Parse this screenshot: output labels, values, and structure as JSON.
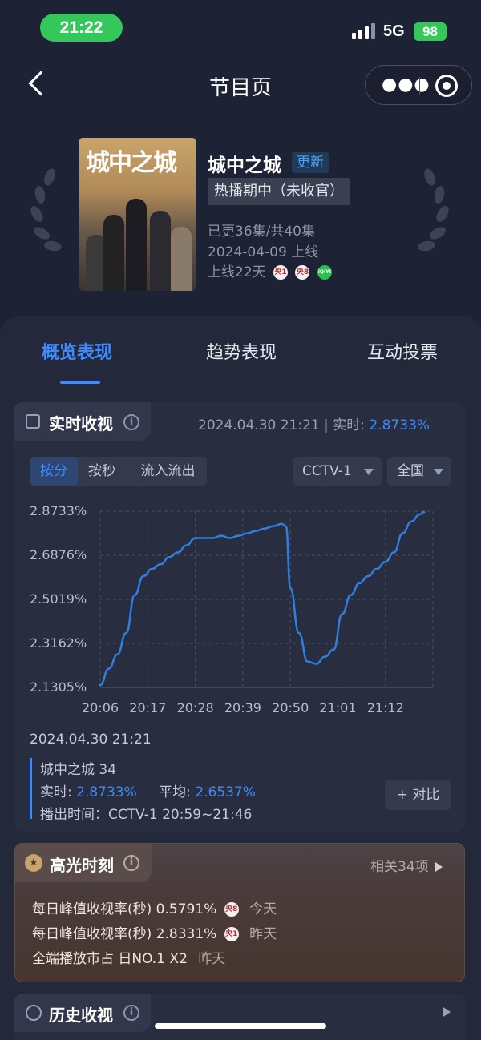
{
  "status_bar": {
    "time": "21:22",
    "network": "5G",
    "battery": "98"
  },
  "nav": {
    "title": "节目页",
    "more_icon": "more-icon",
    "close_icon": "target-icon"
  },
  "show": {
    "poster_title": "城中之城",
    "title": "城中之城",
    "update_tag": "更新",
    "status_tag": "热播期中（未收官）",
    "episodes": "已更36集/共40集",
    "premiere": "2024-04-09 上线",
    "online_days": "上线22天",
    "channels": [
      {
        "label": "央1",
        "color": "#c0282d"
      },
      {
        "label": "央8",
        "color": "#c0282d"
      },
      {
        "label": "iQIYI",
        "color": "#27c24c"
      }
    ]
  },
  "tabs": [
    {
      "label": "概览表现",
      "active": true
    },
    {
      "label": "趋势表现",
      "active": false
    },
    {
      "label": "互动投票",
      "active": false
    }
  ],
  "realtime": {
    "title": "实时收视",
    "timestamp": "2024.04.30 21:21",
    "realtime_label": "实时:",
    "realtime_value": "2.8733%",
    "segments": [
      "按分",
      "按秒",
      "流入流出"
    ],
    "active_segment": "按分",
    "channel_select": "CCTV-1",
    "region_select": "全国"
  },
  "chart_data": {
    "type": "line",
    "title": "",
    "xlabel": "",
    "ylabel": "",
    "y_tick_labels": [
      "2.8733%",
      "2.6876%",
      "2.5019%",
      "2.3162%",
      "2.1305%"
    ],
    "x_tick_labels": [
      "20:06",
      "20:17",
      "20:28",
      "20:39",
      "20:50",
      "21:01",
      "21:12"
    ],
    "ylim": [
      2.1305,
      2.8733
    ],
    "grid": true,
    "line_color": "#2f7fe0",
    "series": [
      {
        "x": [
          "20:06",
          "20:08",
          "20:10",
          "20:12",
          "20:14",
          "20:16",
          "20:18",
          "20:20",
          "20:22",
          "20:24",
          "20:26",
          "20:28",
          "20:30",
          "20:32",
          "20:34",
          "20:36",
          "20:38",
          "20:40",
          "20:42",
          "20:44",
          "20:46",
          "20:48",
          "20:49",
          "20:50",
          "20:52",
          "20:54",
          "20:56",
          "20:58",
          "21:00",
          "21:02",
          "21:04",
          "21:06",
          "21:08",
          "21:10",
          "21:12",
          "21:14",
          "21:16",
          "21:18",
          "21:20",
          "21:21"
        ],
        "values": [
          2.14,
          2.21,
          2.27,
          2.36,
          2.52,
          2.6,
          2.63,
          2.65,
          2.68,
          2.7,
          2.73,
          2.76,
          2.76,
          2.76,
          2.77,
          2.76,
          2.77,
          2.78,
          2.79,
          2.8,
          2.81,
          2.82,
          2.81,
          2.55,
          2.36,
          2.24,
          2.23,
          2.26,
          2.29,
          2.44,
          2.52,
          2.57,
          2.6,
          2.63,
          2.66,
          2.7,
          2.78,
          2.83,
          2.86,
          2.87
        ]
      }
    ]
  },
  "detail": {
    "timestamp": "2024.04.30 21:21",
    "episode": "城中之城 34",
    "realtime_label": "实时:",
    "realtime_value": "2.8733%",
    "average_label": "平均:",
    "average_value": "2.6537%",
    "airtime": "播出时间：CCTV-1 20:59~21:46",
    "compare_button": "+ 对比"
  },
  "highlights": {
    "title": "高光时刻",
    "related": "相关34项",
    "items": [
      {
        "text": "每日峰值收视率(秒)  0.5791%",
        "channel": "央8",
        "when": "今天"
      },
      {
        "text": "每日峰值收视率(秒)  2.8331%",
        "channel": "央1",
        "when": "昨天"
      },
      {
        "text": "全端播放市占  日NO.1 X2",
        "channel": "",
        "when": "昨天"
      }
    ]
  },
  "history": {
    "title": "历史收视"
  }
}
